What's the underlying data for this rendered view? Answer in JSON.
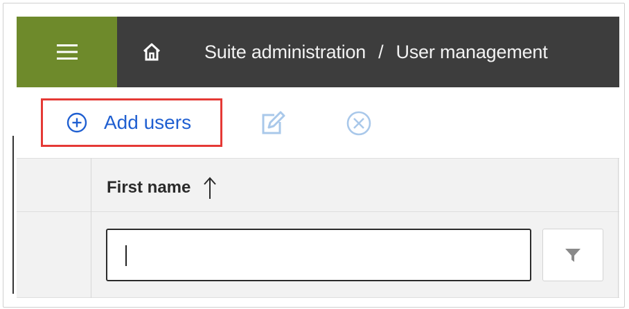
{
  "topbar": {
    "menu_icon": "hamburger-icon",
    "home_icon": "home-icon",
    "breadcrumb": [
      "Suite administration",
      "User management"
    ],
    "separator": "/",
    "colors": {
      "menu_bg": "#6e8a2b",
      "bar_bg": "#3d3d3d"
    }
  },
  "toolbar": {
    "add_users_label": "Add users",
    "add_users_icon": "plus-circle-icon",
    "edit_icon": "edit-icon",
    "delete_icon": "close-circle-icon",
    "colors": {
      "accent": "#1f5fd1",
      "highlight": "#e53935"
    }
  },
  "grid": {
    "columns": [
      {
        "label": "First name",
        "sort": "ascending"
      }
    ],
    "filter": {
      "value": "",
      "placeholder": ""
    },
    "filter_icon": "filter-icon"
  }
}
